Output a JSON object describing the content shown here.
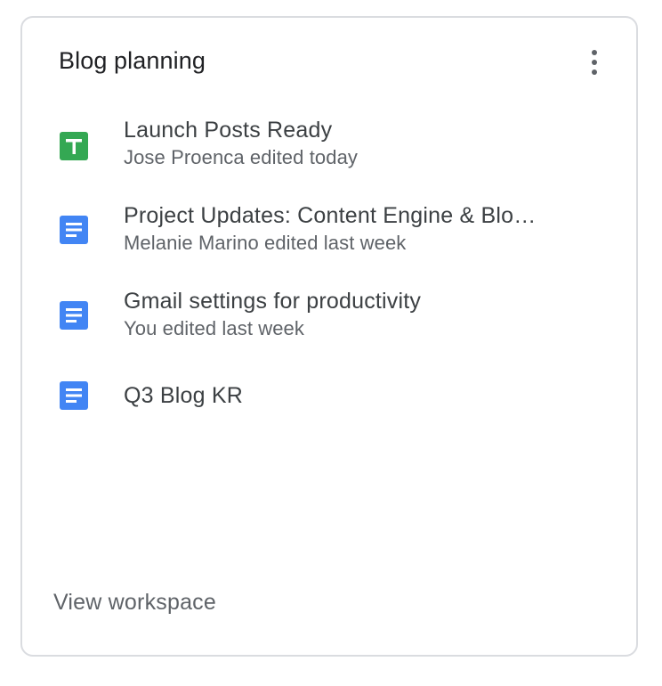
{
  "card": {
    "title": "Blog planning",
    "more_icon": "more-vert-icon",
    "view_link": "View workspace"
  },
  "files": [
    {
      "name": "Launch Posts Ready",
      "meta": "Jose Proenca edited today",
      "icon": "google-sheets-icon",
      "icon_color": "#1e8e3e"
    },
    {
      "name": "Project Updates: Content Engine & Blo…",
      "meta": "Melanie Marino edited last week",
      "icon": "google-docs-icon",
      "icon_color": "#4285f4"
    },
    {
      "name": "Gmail settings for productivity",
      "meta": "You edited last week",
      "icon": "google-docs-icon",
      "icon_color": "#4285f4"
    },
    {
      "name": "Q3 Blog KR",
      "meta": "",
      "icon": "google-docs-icon",
      "icon_color": "#4285f4"
    }
  ]
}
